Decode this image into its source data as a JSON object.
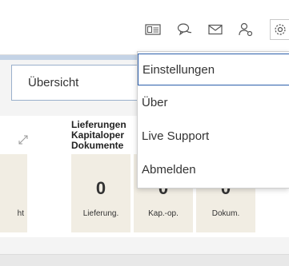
{
  "toolbar": {
    "icons": [
      "id-card-icon",
      "chat-icon",
      "mail-icon",
      "user-settings-icon",
      "gear-icon"
    ]
  },
  "overview": {
    "label": "Übersicht"
  },
  "tile": {
    "heading_lines": [
      "Lieferungen",
      "Kapitaloper",
      "Dokumente"
    ],
    "cards": [
      {
        "value": "",
        "label": "ht"
      },
      {
        "value": "0",
        "label": "Lieferung."
      },
      {
        "value": "0",
        "label": "Kap.-op."
      },
      {
        "value": "0",
        "label": "Dokum."
      }
    ]
  },
  "menu": {
    "items": [
      "Einstellungen",
      "Über",
      "Live Support",
      "Abmelden"
    ],
    "active_index": 0
  },
  "colors": {
    "accent_border": "#2b5eaa",
    "card_bg": "#f1ede3",
    "bluebar": "#c4d3e6"
  }
}
